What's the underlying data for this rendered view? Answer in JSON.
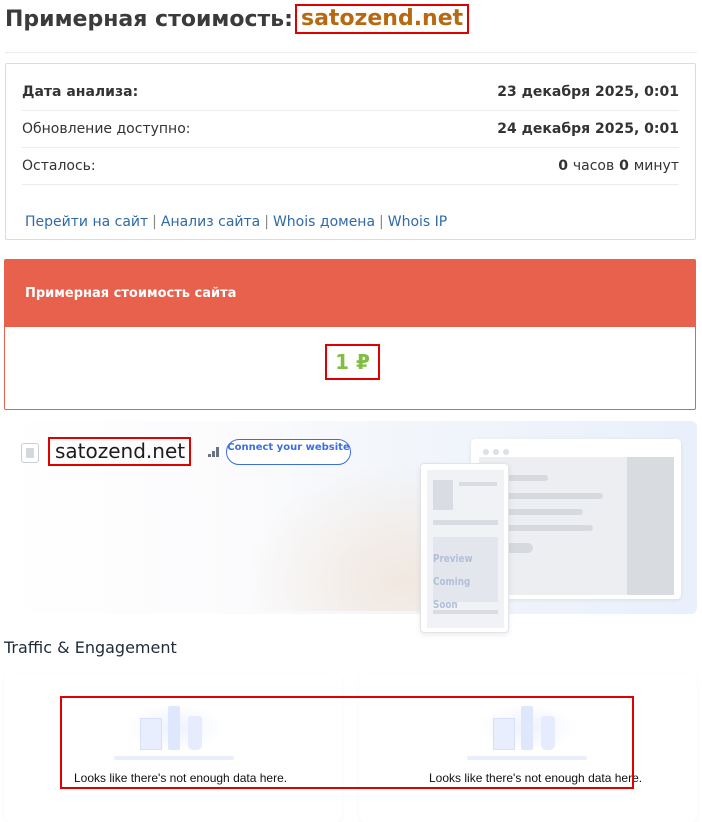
{
  "header": {
    "title_prefix": "Примерная стоимость:",
    "domain": "satozend.net"
  },
  "info": {
    "rows": [
      {
        "label": "Дата анализа:",
        "value": "23 декабря 2025, 0:01"
      },
      {
        "label": "Обновление доступно:",
        "value": "24 декабря 2025, 0:01"
      }
    ],
    "remaining": {
      "label": "Осталось:",
      "hours_num": "0",
      "hours_unit": "часов",
      "minutes_num": "0",
      "minutes_unit": "минут"
    },
    "links": [
      "Перейти на сайт",
      "Анализ сайта",
      "Whois домена",
      "Whois IP"
    ],
    "link_separator": "|"
  },
  "cost": {
    "heading": "Примерная стоимость сайта",
    "value": "1 ₽"
  },
  "similarweb": {
    "domain": "satozend.net",
    "connect_button": "Connect your website",
    "preview_line1": "Preview",
    "preview_line2": "Coming Soon"
  },
  "traffic": {
    "section_title": "Traffic & Engagement",
    "cards": [
      {
        "message": "Looks like there's not enough data here."
      },
      {
        "message": "Looks like there's not enough data here."
      }
    ]
  },
  "colors": {
    "accent_red": "#e8614d",
    "domain_orange": "#b8690f",
    "cost_green": "#7fbf3f",
    "link_blue": "#2f6aa6",
    "button_blue": "#3c6ee0",
    "highlight_red": "#e00000"
  },
  "icons": [
    "favicon-placeholder-icon",
    "rank-bars-icon"
  ]
}
